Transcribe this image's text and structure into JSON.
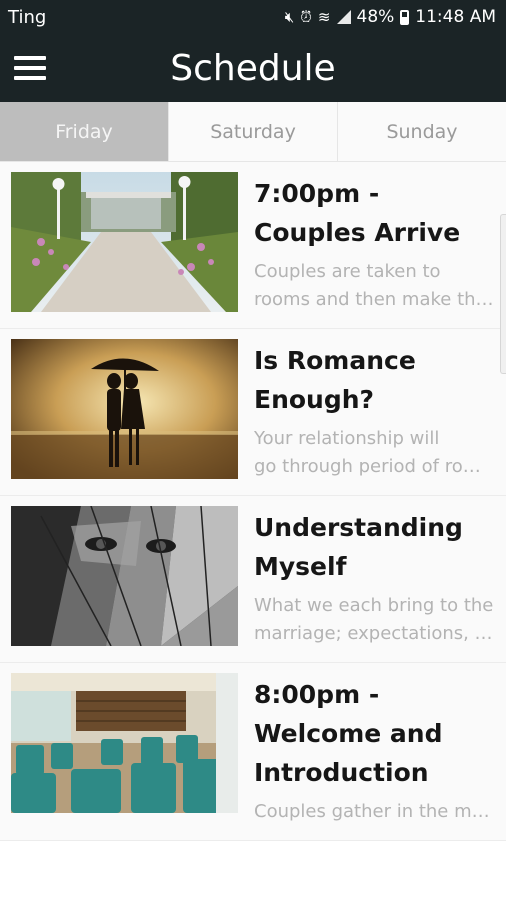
{
  "status_bar": {
    "carrier": "Ting",
    "battery_percent": "48%",
    "time": "11:48 AM",
    "icons": [
      "mute-icon",
      "alarm-icon",
      "wifi-icon",
      "signal-icon",
      "battery-icon"
    ]
  },
  "app_bar": {
    "title": "Schedule",
    "menu_icon": "hamburger-menu-icon"
  },
  "tabs": [
    {
      "label": "Friday",
      "active": true
    },
    {
      "label": "Saturday",
      "active": false
    },
    {
      "label": "Sunday",
      "active": false
    }
  ],
  "items": [
    {
      "title": "7:00pm - Couples Arrive",
      "desc_line1": "Couples are taken to",
      "desc_line2": "rooms and then make th…",
      "image": "garden-walkway-image"
    },
    {
      "title": "Is Romance Enough?",
      "desc_line1": "Your relationship will",
      "desc_line2": "go through period of ro…",
      "image": "couple-umbrella-image"
    },
    {
      "title": "Understanding Myself",
      "desc_line1": "What we each bring to the",
      "desc_line2": "marriage; expectations, …",
      "image": "fractured-face-image"
    },
    {
      "title": "8:00pm - Welcome and Introduction",
      "desc_line1": "Couples gather in the m…",
      "desc_line2": "",
      "image": "meeting-room-image"
    }
  ],
  "colors": {
    "app_bar": "#1b2426",
    "active_tab": "#bdbdbd",
    "title_text": "#161616",
    "desc_text": "#b3b3b3"
  }
}
